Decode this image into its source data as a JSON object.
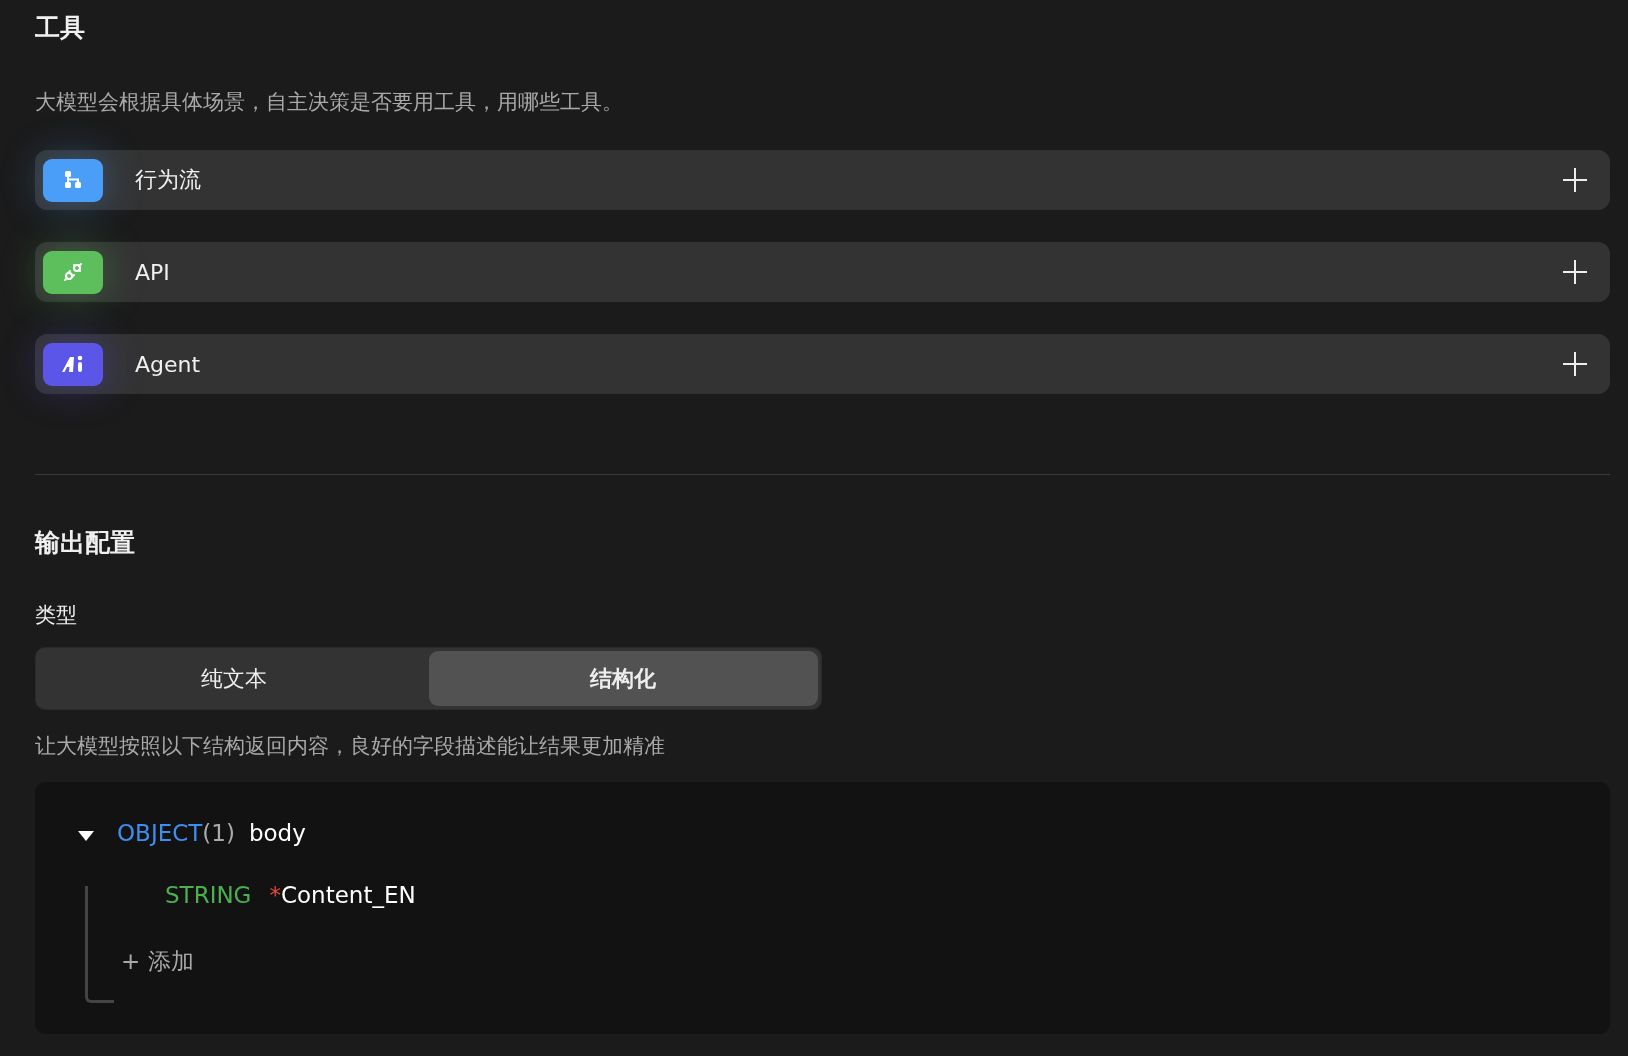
{
  "tools_section": {
    "title": "工具",
    "description": "大模型会根据具体场景，自主决策是否要用工具，用哪些工具。",
    "items": [
      {
        "kind": "flow",
        "label": "行为流",
        "color": "#4a9ef8"
      },
      {
        "kind": "api",
        "label": "API",
        "color": "#5cbf5c"
      },
      {
        "kind": "agent",
        "label": "Agent",
        "color": "#5b55e8"
      }
    ]
  },
  "output_section": {
    "title": "输出配置",
    "type_label": "类型",
    "type_options": [
      {
        "label": "纯文本",
        "selected": false
      },
      {
        "label": "结构化",
        "selected": true
      }
    ],
    "hint": "让大模型按照以下结构返回内容，良好的字段描述能让结果更加精准",
    "schema": {
      "type": "OBJECT",
      "count": "(1)",
      "name": "body",
      "expanded": true,
      "children": [
        {
          "type": "STRING",
          "required_mark": "*",
          "name": "Content_EN"
        }
      ],
      "add_label": "+ 添加"
    }
  }
}
